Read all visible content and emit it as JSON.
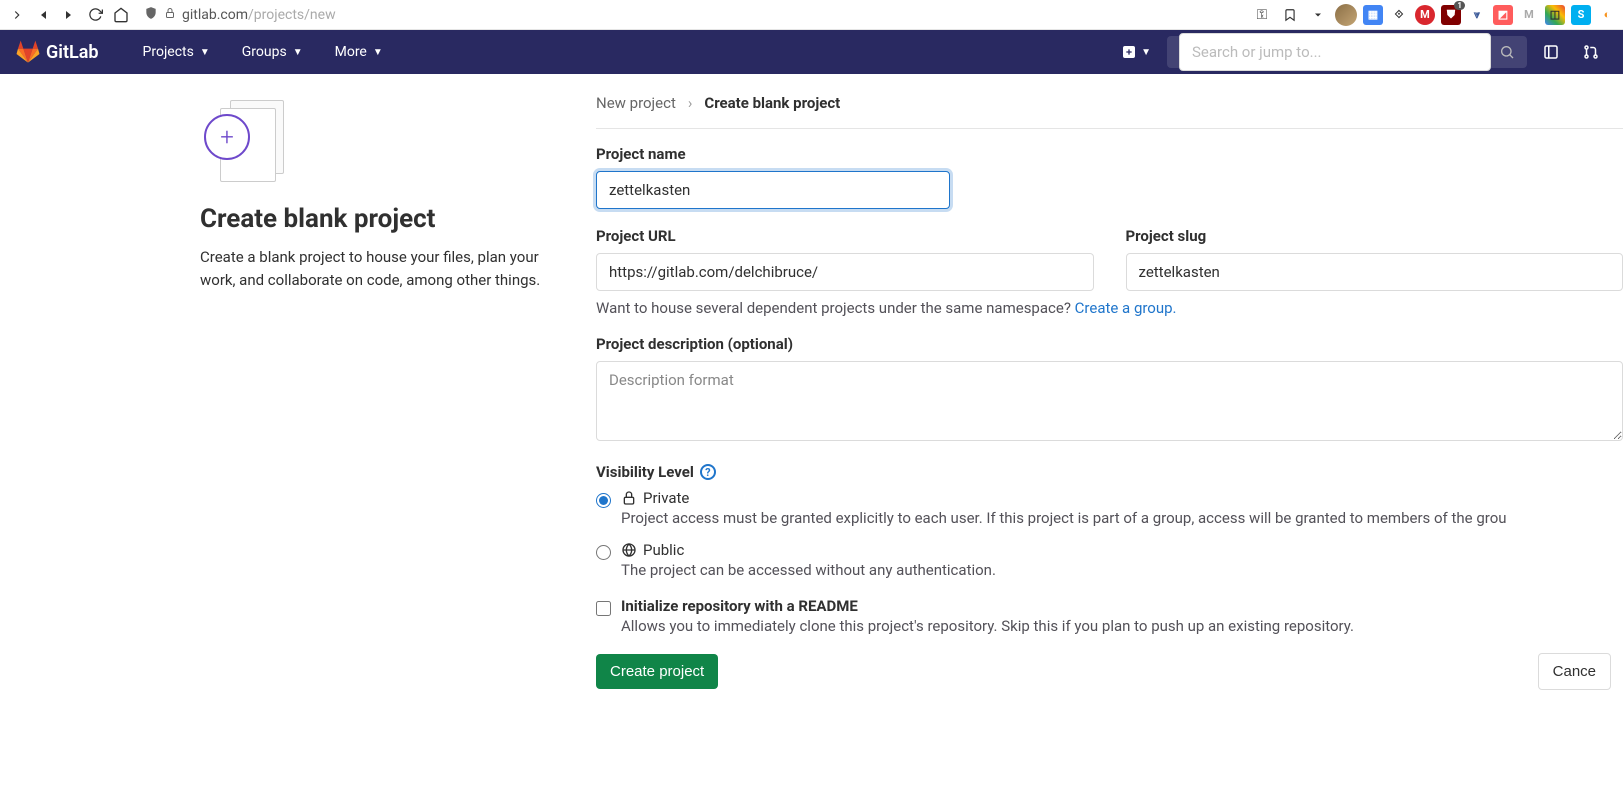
{
  "browser": {
    "url_host": "gitlab.com",
    "url_path": "/projects/new"
  },
  "header": {
    "brand": "GitLab",
    "nav": [
      "Projects",
      "Groups",
      "More"
    ],
    "search_placeholder": "Search or jump to..."
  },
  "left": {
    "title": "Create blank project",
    "desc": "Create a blank project to house your files, plan your work, and collaborate on code, among other things."
  },
  "breadcrumb": {
    "root": "New project",
    "current": "Create blank project"
  },
  "form": {
    "project_name_label": "Project name",
    "project_name_value": "zettelkasten",
    "project_url_label": "Project URL",
    "project_url_value": "https://gitlab.com/delchibruce/",
    "project_slug_label": "Project slug",
    "project_slug_value": "zettelkasten",
    "namespace_help": "Want to house several dependent projects under the same namespace?",
    "namespace_link": "Create a group.",
    "desc_label": "Project description (optional)",
    "desc_placeholder": "Description format",
    "visibility_label": "Visibility Level",
    "visibility": {
      "private_label": "Private",
      "private_desc": "Project access must be granted explicitly to each user. If this project is part of a group, access will be granted to members of the grou",
      "public_label": "Public",
      "public_desc": "The project can be accessed without any authentication."
    },
    "readme_label": "Initialize repository with a README",
    "readme_desc": "Allows you to immediately clone this project's repository. Skip this if you plan to push up an existing repository.",
    "submit": "Create project",
    "cancel": "Cance"
  }
}
